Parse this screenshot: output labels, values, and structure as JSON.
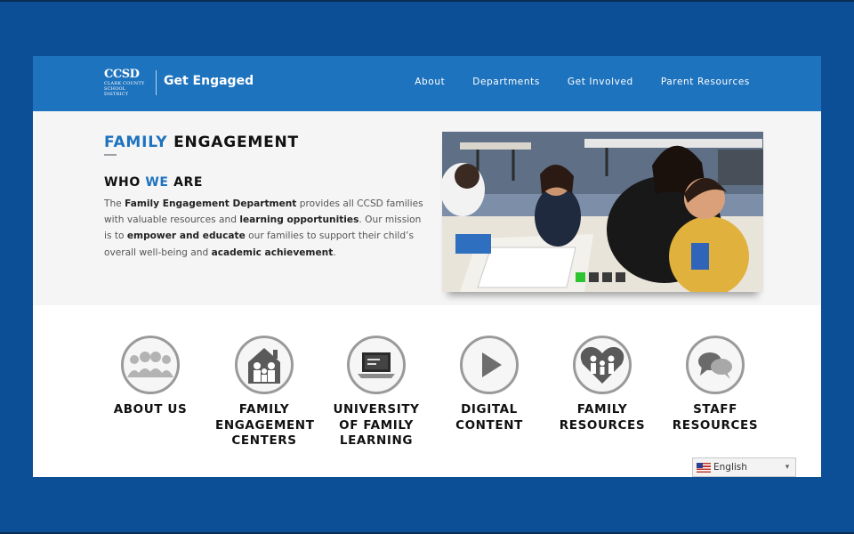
{
  "header": {
    "logo_main": "CCSD",
    "logo_sub": "CLARK COUNTY SCHOOL DISTRICT",
    "brand": "Get Engaged",
    "nav": [
      "About",
      "Departments",
      "Get Involved",
      "Parent Resources"
    ]
  },
  "hero": {
    "title_accent": "FAMILY",
    "title_rest": "ENGAGEMENT",
    "who_1": "WHO",
    "who_accent": "WE",
    "who_2": "ARE",
    "desc": [
      "The ",
      "Family Engagement Department",
      " provides all CCSD families with valuable resources and ",
      "learning opportunities",
      ". Our mission is to ",
      "empower and educate",
      " our families to support their child’s overall well-being and ",
      "academic achievement",
      "."
    ],
    "slider": {
      "slide_count": 4,
      "active_slide": 1
    }
  },
  "features": [
    {
      "label": "ABOUT US",
      "icon": "group-icon"
    },
    {
      "label": "FAMILY ENGAGEMENT CENTERS",
      "icon": "family-house-icon"
    },
    {
      "label": "UNIVERSITY OF FAMILY LEARNING",
      "icon": "laptop-icon"
    },
    {
      "label": "DIGITAL CONTENT",
      "icon": "play-icon"
    },
    {
      "label": "FAMILY RESOURCES",
      "icon": "family-heart-icon"
    },
    {
      "label": "STAFF RESOURCES",
      "icon": "chat-bubbles-icon"
    }
  ],
  "language": {
    "selected": "English",
    "icon": "us-flag-icon"
  },
  "colors": {
    "brand_blue": "#1e73be",
    "page_bg": "#0d4f96",
    "slider_active": "#2ec431"
  }
}
